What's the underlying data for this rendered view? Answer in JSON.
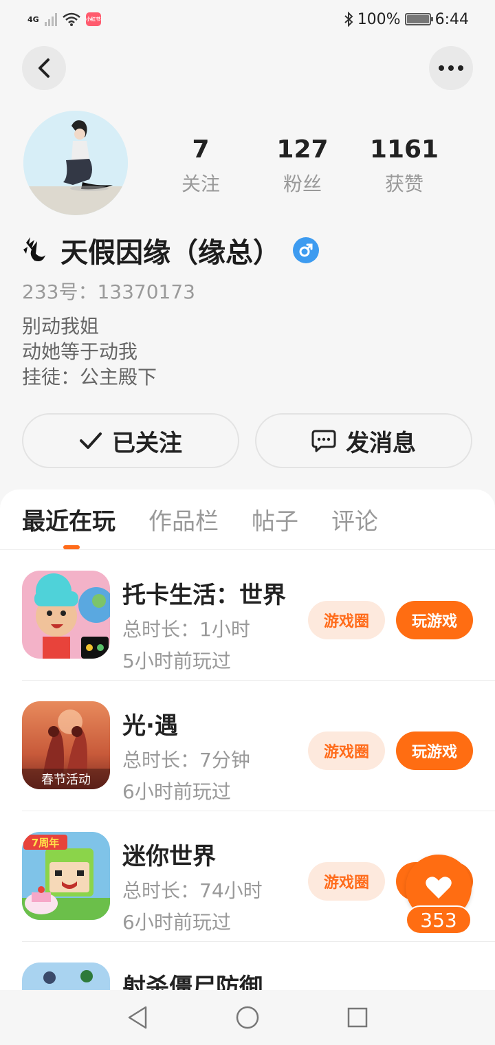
{
  "status_bar": {
    "network": "4G",
    "app_badge": "小红书",
    "battery": "100%",
    "time": "6:44"
  },
  "profile": {
    "stats": [
      {
        "value": "7",
        "label": "关注"
      },
      {
        "value": "127",
        "label": "粉丝"
      },
      {
        "value": "1161",
        "label": "获赞"
      }
    ],
    "username": "天假因缘（缘总）",
    "user_id": "233号：13370173",
    "bio": [
      "别动我姐",
      "动她等于动我",
      "挂徒：公主殿下"
    ],
    "follow_label": "已关注",
    "message_label": "发消息"
  },
  "tabs": [
    "最近在玩",
    "作品栏",
    "帖子",
    "评论"
  ],
  "games": [
    {
      "name": "托卡生活：世界",
      "duration": "总时长：1小时",
      "last": "5小时前玩过",
      "circle": "游戏圈",
      "play": "玩游戏"
    },
    {
      "name": "光·遇",
      "duration": "总时长：7分钟",
      "last": "6小时前玩过",
      "circle": "游戏圈",
      "play": "玩游戏",
      "icon_text": "春节活动"
    },
    {
      "name": "迷你世界",
      "duration": "总时长：74小时",
      "last": "6小时前玩过",
      "circle": "游戏圈",
      "play": "玩游戏",
      "icon_text": "7周年"
    },
    {
      "name": "射杀僵尸防御"
    }
  ],
  "like": {
    "count": "353"
  },
  "colors": {
    "accent": "#ff6d12",
    "tag_bg": "#fde9dd",
    "gender": "#3d9bf0"
  }
}
